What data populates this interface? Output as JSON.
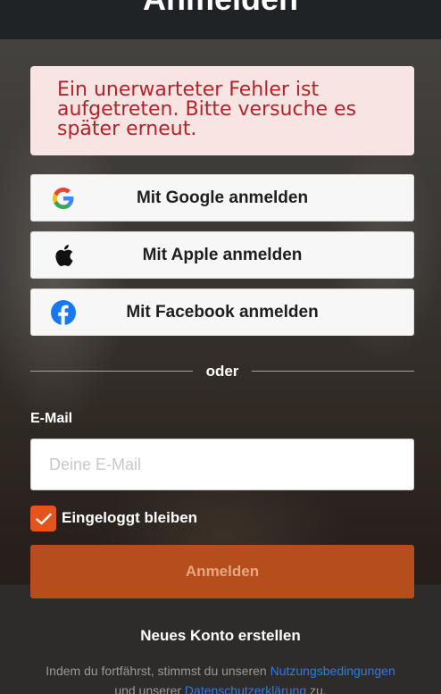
{
  "header": {
    "title": "Anmelden"
  },
  "error": {
    "message": "Ein unerwarteter Fehler ist aufgetreten. Bitte versuche es später erneut."
  },
  "social": {
    "google_label": "Mit Google anmelden",
    "apple_label": "Mit Apple anmelden",
    "facebook_label": "Mit Facebook anmelden"
  },
  "divider": {
    "text": "oder"
  },
  "form": {
    "email_label": "E-Mail",
    "email_placeholder": "Deine E-Mail",
    "email_value": "",
    "remember_label": "Eingeloggt bleiben",
    "remember_checked": true,
    "submit_label": "Anmelden"
  },
  "footer": {
    "new_account": "Neues Konto erstellen",
    "terms_prefix": "Indem du fortfährst, stimmst du unseren ",
    "terms_link": "Nutzungsbedingungen",
    "terms_middle": " und unserer ",
    "privacy_link": "Datenschutzerklärung",
    "terms_suffix": " zu."
  },
  "colors": {
    "accent": "#e4551d",
    "submit_bg": "#b64d1d",
    "error_bg": "#f9e4e4",
    "error_text": "#b0242a",
    "link": "#2f7ae5"
  },
  "icons": [
    "google-icon",
    "apple-icon",
    "facebook-icon",
    "checkmark-icon"
  ]
}
